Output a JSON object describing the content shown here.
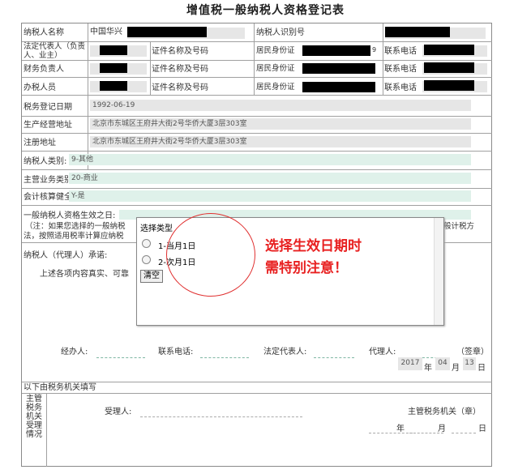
{
  "title": "增值税一般纳税人资格登记表",
  "rows": {
    "taxpayer_name_label": "纳税人名称",
    "taxpayer_name_value": "中国华兴",
    "taxpayer_id_label": "纳税人识别号",
    "legal_rep_label_1": "法定代表人（负责",
    "legal_rep_label_2": "人、业主）",
    "finance_label": "财务负责人",
    "tax_officer_label": "办税人员",
    "id_type_label": "证件名称及号码",
    "id_type_value": "居民身份证",
    "id_suffix": "9",
    "phone_label": "联系电话",
    "reg_date_label": "税务登记日期",
    "reg_date_value": "1992-06-19",
    "biz_addr_label": "生产经营地址",
    "biz_addr_value": "北京市东城区王府井大街2号华侨大厦3层303室",
    "reg_addr_label": "注册地址",
    "reg_addr_value": "北京市东城区王府井大街2号华侨大厦3层303室",
    "taxpayer_type_label": "纳税人类别:",
    "taxpayer_type_value": "9-其他",
    "main_biz_label": "主营业务类别:",
    "main_biz_value": "20-商业",
    "accounting_label": "会计核算健全:",
    "accounting_value": "Y-是",
    "effective_label": "一般纳税人资格生效之日:",
    "note_1": "（注：如果您选择的一般纳税",
    "note_1_tail": "般计税方",
    "note_2": "法，按照适用税率计算应纳税",
    "promise_label": "纳税人（代理人）承诺:",
    "promise_text": "上述各项内容真实、可靠",
    "handler_label": "经办人:",
    "contact_label": "联系电话:",
    "legal_label": "法定代表人:",
    "agent_label": "代理人:",
    "seal_label": "（签章）",
    "year_value": "2017",
    "month_value": "04",
    "day_value": "13",
    "year_unit": "年",
    "month_unit": "月",
    "day_unit": "日",
    "office_fill_label": "以下由税务机关填写",
    "authority_label": [
      "主管",
      "税务",
      "机关",
      "受理",
      "情况"
    ],
    "receiver_label": "受理人:",
    "authority_seal_label": "主管税务机关（章）"
  },
  "popup": {
    "title": "选择类型",
    "options": [
      "1-当月1日",
      "2-次月1日"
    ],
    "clear_button": "清空"
  },
  "annotation": {
    "line1": "选择生效日期时",
    "line2": "需特别注意！",
    "color": "#e82020"
  }
}
